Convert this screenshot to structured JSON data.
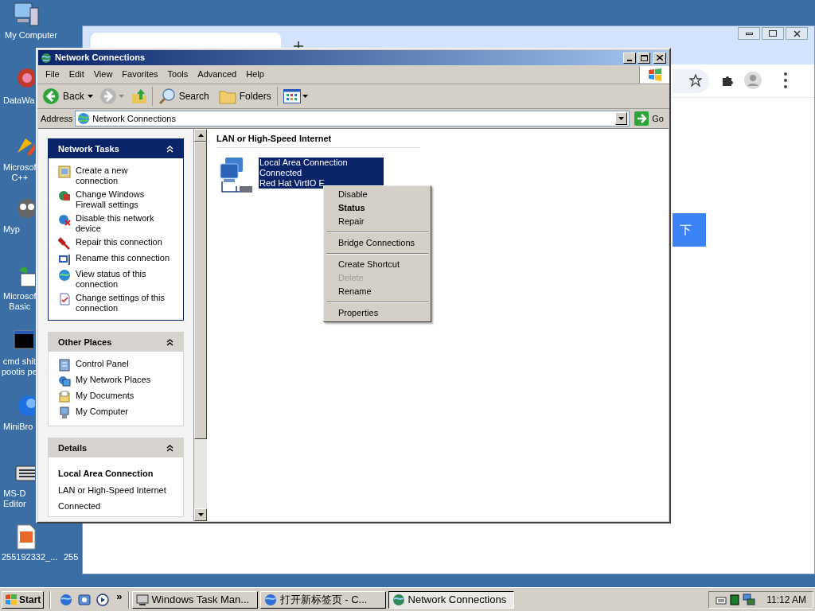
{
  "desktop": {
    "icons": [
      {
        "lines": [
          "My Computer"
        ]
      },
      {
        "lines": [
          "DataWa"
        ]
      },
      {
        "lines": [
          "Microsof",
          "C++"
        ]
      },
      {
        "lines": [
          "Myp"
        ]
      },
      {
        "lines": [
          "Microsof",
          "Basic"
        ]
      },
      {
        "lines": [
          "cmd shit",
          "pootis pe"
        ]
      },
      {
        "lines": [
          "MiniBro"
        ]
      },
      {
        "lines": [
          "MS-D",
          "Editor"
        ]
      },
      {
        "lines": [
          "255192332_..."
        ]
      },
      {
        "lines": [
          "255"
        ]
      }
    ]
  },
  "browser": {
    "button": "下"
  },
  "explorer": {
    "title": "Network Connections",
    "menu": [
      "File",
      "Edit",
      "View",
      "Favorites",
      "Tools",
      "Advanced",
      "Help"
    ],
    "toolbar": {
      "back": "Back",
      "search": "Search",
      "folders": "Folders"
    },
    "address": {
      "label": "Address",
      "value": "Network Connections",
      "go": "Go"
    },
    "panes": [
      {
        "title": "Network Tasks",
        "kind": "special",
        "items": [
          "Create a new connection",
          "Change Windows Firewall settings",
          "Disable this network device",
          "Repair this connection",
          "Rename this connection",
          "View status of this connection",
          "Change settings of this connection"
        ]
      },
      {
        "title": "Other Places",
        "kind": "normal",
        "items": [
          "Control Panel",
          "My Network Places",
          "My Documents",
          "My Computer"
        ]
      }
    ],
    "details": {
      "title": "Details",
      "name": "Local Area Connection",
      "lines": [
        "LAN or High-Speed Internet",
        "Connected"
      ]
    },
    "group_heading": "LAN or High-Speed Internet",
    "connection": {
      "selected": true,
      "lines": [
        "Local Area Connection",
        "Connected",
        "Red Hat VirtIO E"
      ]
    }
  },
  "context_menu": {
    "items": [
      {
        "kind": "item",
        "label": "Disable",
        "bold": false,
        "disabled": false
      },
      {
        "kind": "item",
        "label": "Status",
        "bold": true,
        "disabled": false
      },
      {
        "kind": "item",
        "label": "Repair",
        "bold": false,
        "disabled": false
      },
      {
        "kind": "separator"
      },
      {
        "kind": "item",
        "label": "Bridge Connections",
        "bold": false,
        "disabled": false
      },
      {
        "kind": "separator"
      },
      {
        "kind": "item",
        "label": "Create Shortcut",
        "bold": false,
        "disabled": false
      },
      {
        "kind": "item",
        "label": "Delete",
        "bold": false,
        "disabled": true
      },
      {
        "kind": "item",
        "label": "Rename",
        "bold": false,
        "disabled": false
      },
      {
        "kind": "separator"
      },
      {
        "kind": "item",
        "label": "Properties",
        "bold": false,
        "disabled": false
      }
    ]
  },
  "taskbar": {
    "start": "Start",
    "more": "»",
    "tasks": [
      {
        "label": "Windows Task Man...",
        "selected": false
      },
      {
        "label": "打开新标签页 - C...",
        "selected": false
      },
      {
        "label": "Network Connections",
        "selected": true
      }
    ],
    "clock": "11:12 AM"
  }
}
